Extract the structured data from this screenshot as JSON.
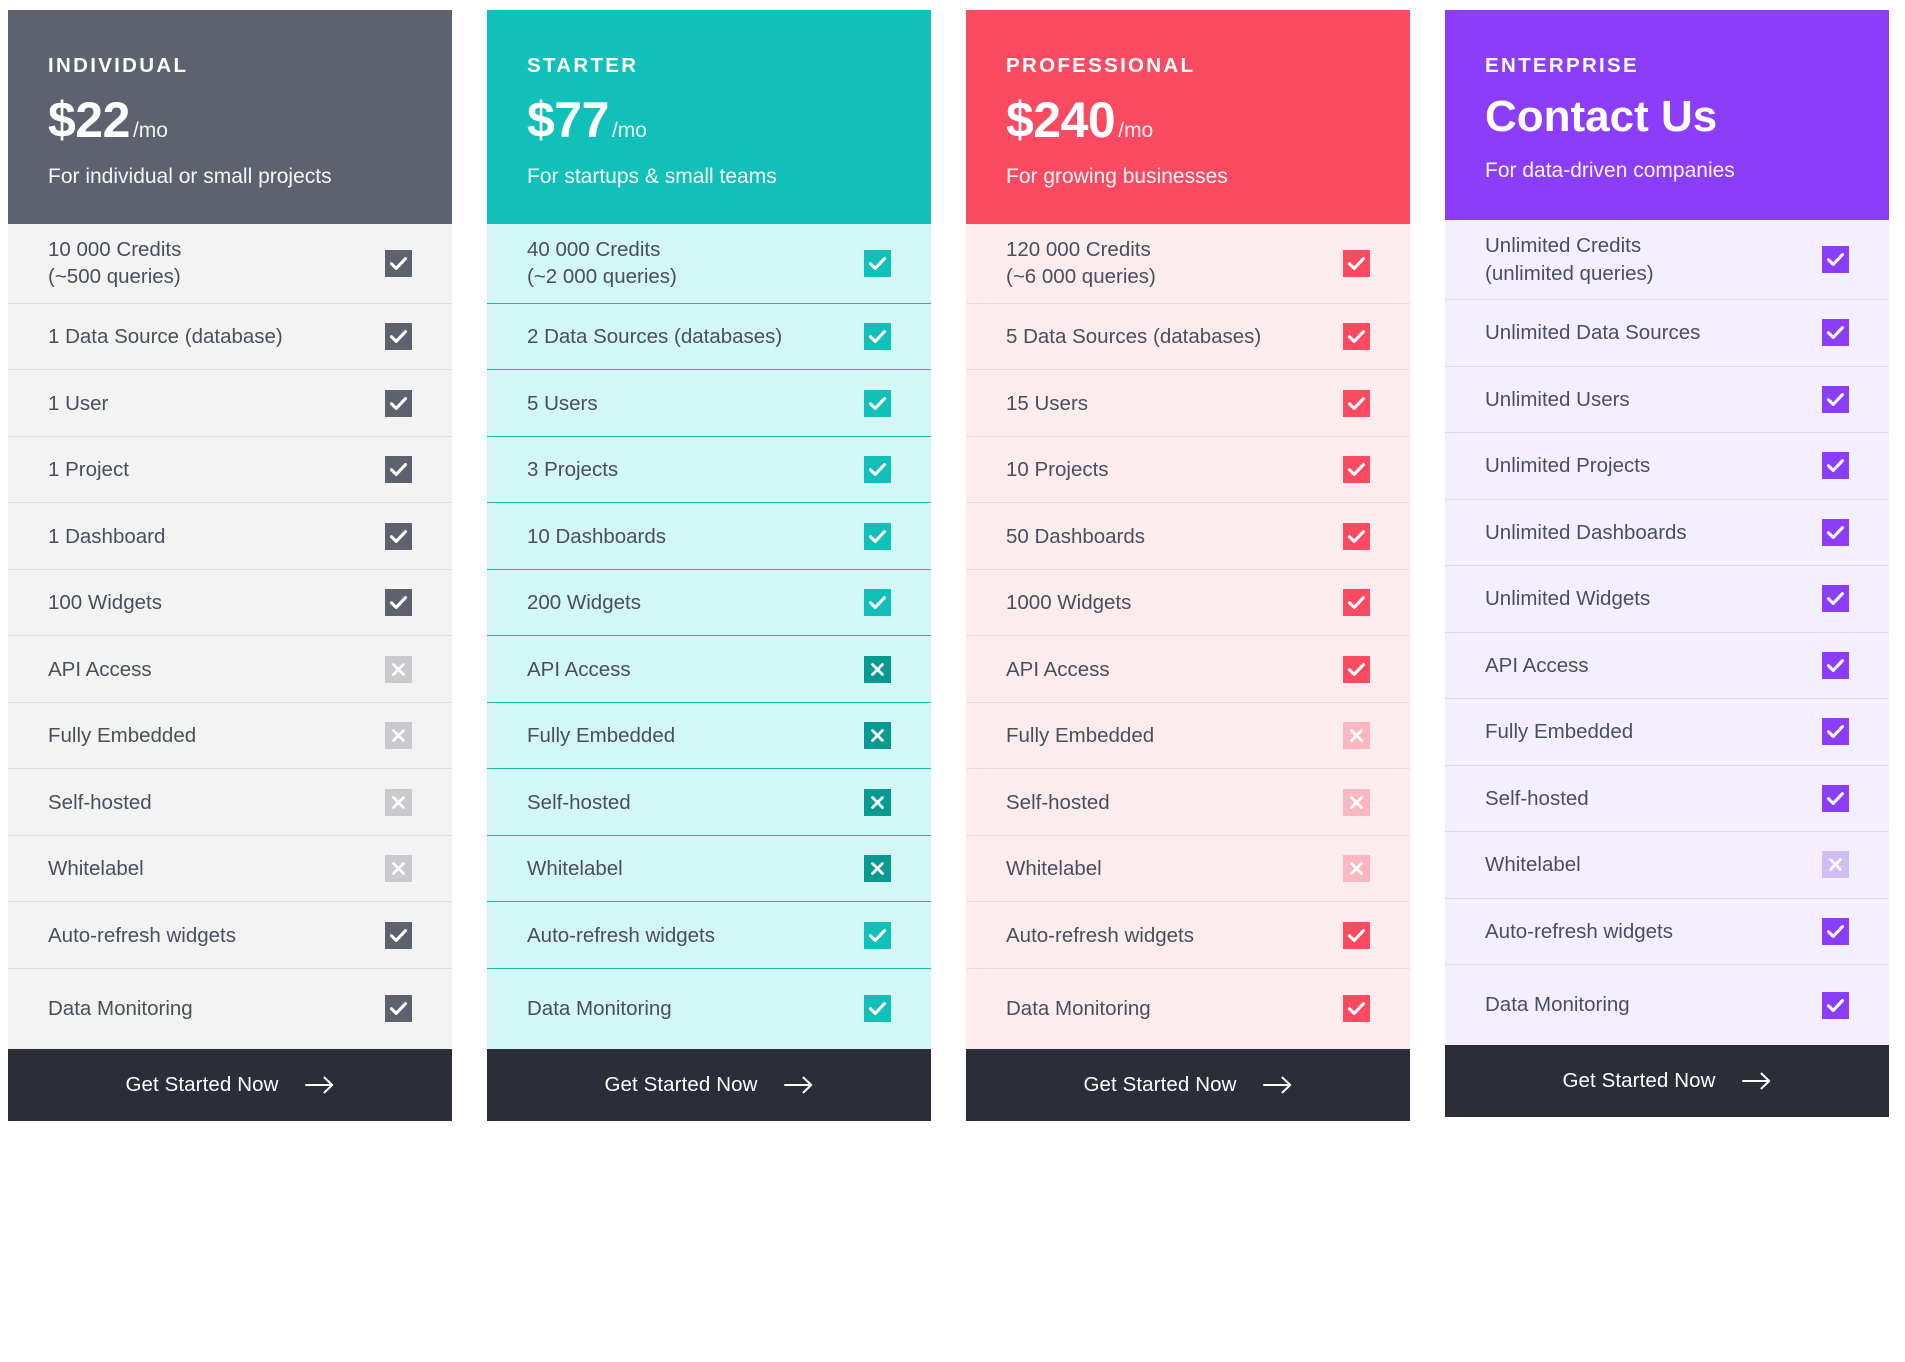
{
  "colors": {
    "individual": "#5e616e",
    "individual_body": "#f3f3f4",
    "individual_border": "#dedee0",
    "individual_mark_on": "#5e616e",
    "individual_mark_off": "#c9cacd",
    "starter": "#11c0b8",
    "starter_body": "#d2f7f4",
    "starter_border": "#1fb5ac",
    "starter_mark_on": "#11c0b8",
    "starter_mark_off": "#069a93",
    "professional": "#fa4a61",
    "professional_body": "#fdeced",
    "professional_border": "#fbd5d9",
    "professional_mark_on": "#fa4a61",
    "professional_mark_off": "#fbb7c1",
    "enterprise": "#8b3dfa",
    "enterprise_body": "#f4efff",
    "enterprise_border": "#e0d4f7",
    "enterprise_mark_on": "#8b3dfa",
    "enterprise_mark_off": "#cfbdf5",
    "cta_background": "#2b2d38",
    "label_text": "#4a4f5c"
  },
  "cta": {
    "label": "Get Started Now",
    "icon": "arrow-right-icon"
  },
  "plans": [
    {
      "id": "individual",
      "name": "INDIVIDUAL",
      "price": "$22",
      "period": "/mo",
      "tagline": "For individual or small projects",
      "features": [
        {
          "label": "10 000 Credits\n(~500 queries)",
          "state": "check",
          "tall": true
        },
        {
          "label": "1 Data Source (database)",
          "state": "check",
          "tall": false
        },
        {
          "label": "1 User",
          "state": "check",
          "tall": false
        },
        {
          "label": "1 Project",
          "state": "check",
          "tall": false
        },
        {
          "label": "1 Dashboard",
          "state": "check",
          "tall": false
        },
        {
          "label": "100 Widgets",
          "state": "check",
          "tall": false
        },
        {
          "label": "API Access",
          "state": "cross",
          "tall": false
        },
        {
          "label": "Fully Embedded",
          "state": "cross",
          "tall": false
        },
        {
          "label": "Self-hosted",
          "state": "cross",
          "tall": false
        },
        {
          "label": "Whitelabel",
          "state": "cross",
          "tall": false
        },
        {
          "label": "Auto-refresh widgets",
          "state": "check",
          "tall": false
        },
        {
          "label": "Data Monitoring",
          "state": "check",
          "tall": false
        }
      ]
    },
    {
      "id": "starter",
      "name": "STARTER",
      "price": "$77",
      "period": "/mo",
      "tagline": "For startups & small teams",
      "features": [
        {
          "label": "40 000 Credits\n(~2 000 queries)",
          "state": "check",
          "tall": true
        },
        {
          "label": "2 Data Sources (databases)",
          "state": "check",
          "tall": false
        },
        {
          "label": "5 Users",
          "state": "check",
          "tall": false
        },
        {
          "label": "3 Projects",
          "state": "check",
          "tall": false
        },
        {
          "label": "10 Dashboards",
          "state": "check",
          "tall": false
        },
        {
          "label": "200 Widgets",
          "state": "check",
          "tall": false
        },
        {
          "label": "API Access",
          "state": "cross",
          "tall": false
        },
        {
          "label": "Fully Embedded",
          "state": "cross",
          "tall": false
        },
        {
          "label": "Self-hosted",
          "state": "cross",
          "tall": false
        },
        {
          "label": "Whitelabel",
          "state": "cross",
          "tall": false
        },
        {
          "label": "Auto-refresh widgets",
          "state": "check",
          "tall": false
        },
        {
          "label": "Data Monitoring",
          "state": "check",
          "tall": false
        }
      ]
    },
    {
      "id": "professional",
      "name": "PROFESSIONAL",
      "price": "$240",
      "period": "/mo",
      "tagline": "For growing businesses",
      "features": [
        {
          "label": "120 000 Credits\n(~6 000 queries)",
          "state": "check",
          "tall": true
        },
        {
          "label": "5 Data Sources (databases)",
          "state": "check",
          "tall": false
        },
        {
          "label": "15 Users",
          "state": "check",
          "tall": false
        },
        {
          "label": "10 Projects",
          "state": "check",
          "tall": false
        },
        {
          "label": "50 Dashboards",
          "state": "check",
          "tall": false
        },
        {
          "label": "1000 Widgets",
          "state": "check",
          "tall": false
        },
        {
          "label": "API Access",
          "state": "check",
          "tall": false
        },
        {
          "label": "Fully Embedded",
          "state": "cross",
          "tall": false
        },
        {
          "label": "Self-hosted",
          "state": "cross",
          "tall": false
        },
        {
          "label": "Whitelabel",
          "state": "cross",
          "tall": false
        },
        {
          "label": "Auto-refresh widgets",
          "state": "check",
          "tall": false
        },
        {
          "label": "Data Monitoring",
          "state": "check",
          "tall": false
        }
      ]
    },
    {
      "id": "enterprise",
      "name": "ENTERPRISE",
      "price": "Contact Us",
      "period": "",
      "tagline": "For data-driven companies",
      "features": [
        {
          "label": "Unlimited Credits\n(unlimited queries)",
          "state": "check",
          "tall": true
        },
        {
          "label": "Unlimited Data Sources",
          "state": "check",
          "tall": false
        },
        {
          "label": "Unlimited Users",
          "state": "check",
          "tall": false
        },
        {
          "label": "Unlimited Projects",
          "state": "check",
          "tall": false
        },
        {
          "label": "Unlimited Dashboards",
          "state": "check",
          "tall": false
        },
        {
          "label": "Unlimited Widgets",
          "state": "check",
          "tall": false
        },
        {
          "label": "API Access",
          "state": "check",
          "tall": false
        },
        {
          "label": "Fully Embedded",
          "state": "check",
          "tall": false
        },
        {
          "label": "Self-hosted",
          "state": "check",
          "tall": false
        },
        {
          "label": "Whitelabel",
          "state": "cross",
          "tall": false
        },
        {
          "label": "Auto-refresh widgets",
          "state": "check",
          "tall": false
        },
        {
          "label": "Data Monitoring",
          "state": "check",
          "tall": false
        }
      ]
    }
  ]
}
